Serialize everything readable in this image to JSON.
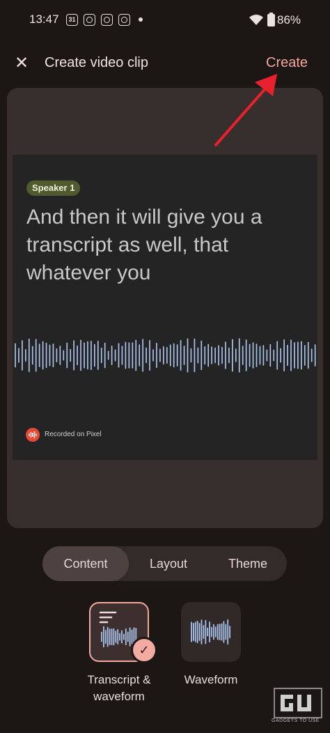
{
  "status_bar": {
    "time": "13:47",
    "calendar_day": "31",
    "battery": "86%"
  },
  "header": {
    "close_label": "✕",
    "title": "Create video clip",
    "create_label": "Create"
  },
  "preview": {
    "speaker": "Speaker 1",
    "transcript": "And then it will give you a transcript as well, that whatever you",
    "recorded_label": "Recorded on Pixel"
  },
  "tabs": [
    {
      "label": "Content",
      "selected": true
    },
    {
      "label": "Layout",
      "selected": false
    },
    {
      "label": "Theme",
      "selected": false
    }
  ],
  "options": [
    {
      "label": "Transcript & waveform",
      "selected": true
    },
    {
      "label": "Waveform",
      "selected": false
    }
  ],
  "watermark": {
    "text": "GADGETS TO USE"
  },
  "colors": {
    "accent": "#f3a79d",
    "background": "#1c1615",
    "waveform": "#a9c3ec",
    "arrow": "#e8222c"
  }
}
